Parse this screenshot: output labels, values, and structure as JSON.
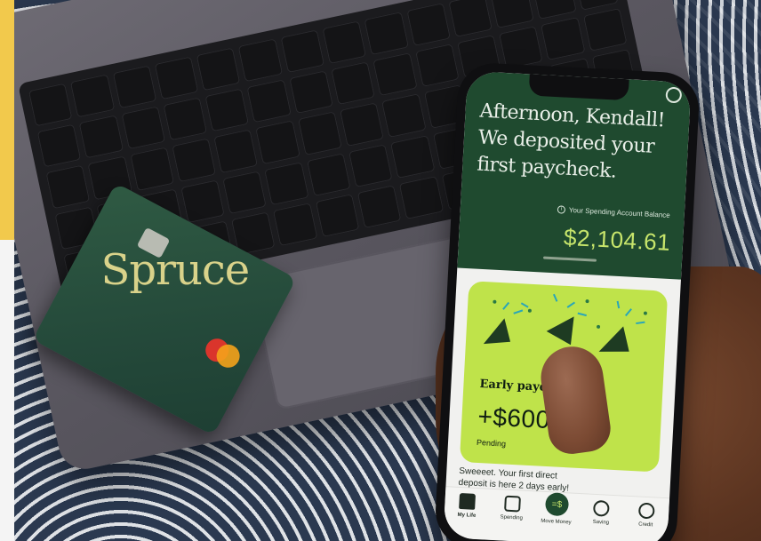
{
  "card": {
    "brand": "Spruce"
  },
  "phone": {
    "greeting": "Afternoon, Kendall!\nWe deposited your\nfirst paycheck.",
    "balance_label": "Your Spending Account Balance",
    "balance": "$2,104.61",
    "promo": {
      "title": "Early payday!",
      "amount": "+$600",
      "status": "Pending"
    },
    "message": "Sweeeet. Your first direct\ndeposit is here 2 days early!",
    "nav": [
      {
        "label": "My Life",
        "icon": "home-icon",
        "active": true
      },
      {
        "label": "Spending",
        "icon": "card-icon"
      },
      {
        "label": "Move Money",
        "icon": "move-money-icon",
        "badge": "=$"
      },
      {
        "label": "Saving",
        "icon": "piggy-bank-icon"
      },
      {
        "label": "Credit",
        "icon": "gauge-icon"
      }
    ]
  },
  "colors": {
    "spruce_green": "#1f4a2f",
    "lime": "#bfe34a",
    "balance_lime": "#c7e56b",
    "yellow_bar": "#f2c94c"
  }
}
